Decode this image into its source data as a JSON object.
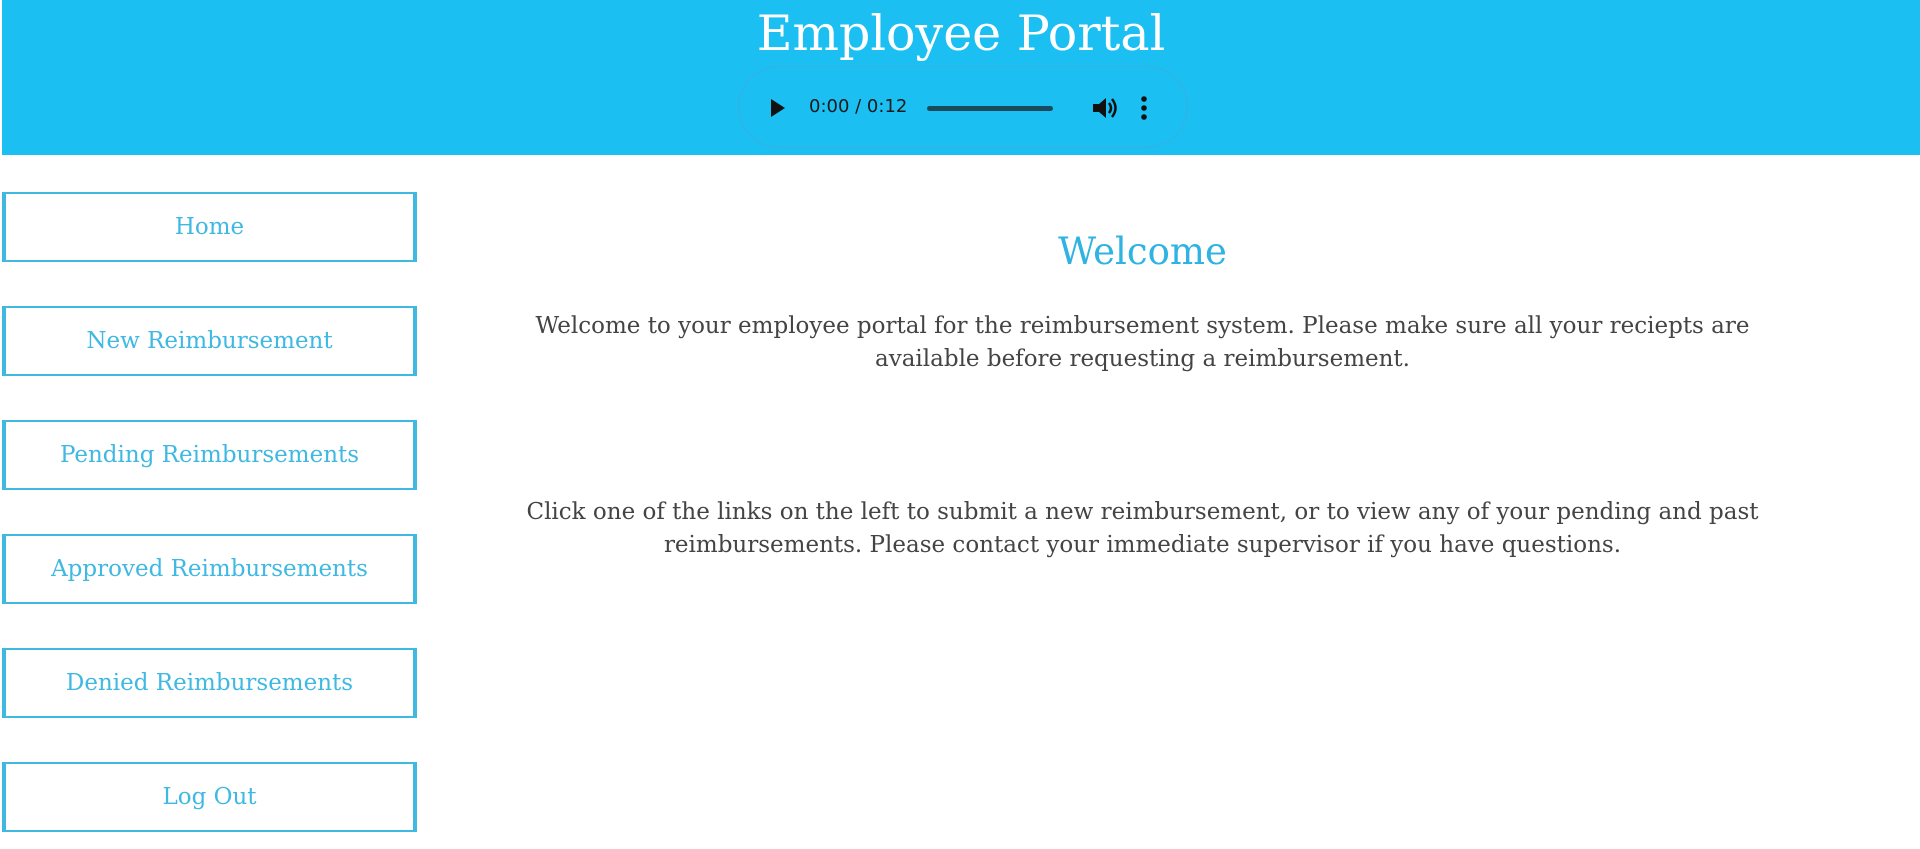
{
  "header": {
    "title": "Employee Portal",
    "background_color": "#1bbff2"
  },
  "audio_player": {
    "time": "0:00 / 0:12",
    "progress": 0,
    "play_icon": "play-icon",
    "volume_icon": "volume-icon",
    "more_icon": "more-vert-icon"
  },
  "nav": {
    "accent_color": "#3fb8e2",
    "items": [
      {
        "label": "Home"
      },
      {
        "label": "New Reimbursement"
      },
      {
        "label": "Pending Reimbursements"
      },
      {
        "label": "Approved Reimbursements"
      },
      {
        "label": "Denied Reimbursements"
      },
      {
        "label": "Log Out"
      }
    ]
  },
  "main": {
    "heading": "Welcome",
    "paragraph1": "Welcome to your employee portal for the reimbursement system. Please make sure all your reciepts are available before requesting a reimbursement.",
    "paragraph2": "Click one of the links on the left to submit a new reimbursement, or to view any of your pending and past reimbursements. Please contact your immediate supervisor if you have questions."
  }
}
